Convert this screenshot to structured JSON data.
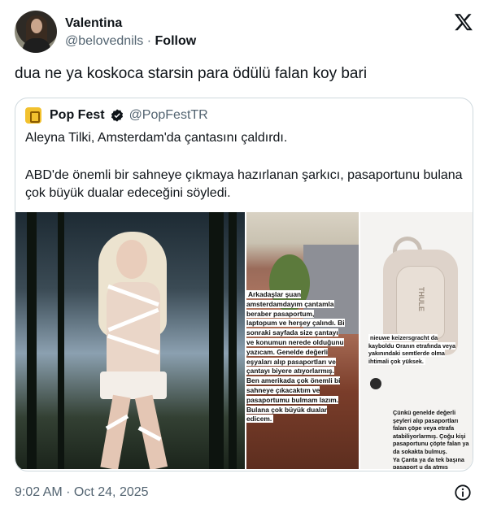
{
  "author": {
    "name": "Valentina",
    "handle": "@belovednils",
    "separator": " · ",
    "follow_label": "Follow"
  },
  "tweet": {
    "text": "dua ne ya koskoca starsin para ödülü falan koy bari",
    "timestamp": "9:02 AM · Oct 24, 2025"
  },
  "quoted": {
    "name": "Pop Fest",
    "handle": "@PopFestTR",
    "line1": "Aleyna Tilki, Amsterdam'da çantasını çaldırdı.",
    "line2": "ABD'de önemli bir sahneye çıkmaya hazırlanan şarkıcı, pasaportunu bulana çok büyük dualar edeceğini söyledi."
  },
  "media": {
    "story_text": "Arkadaşlar şuan amsterdamdayım çantamla beraber pasaportum, laptopum ve herşey çalındı. Bi sonraki sayfada size çantayı ve konumun nerede olduğunu yazıcam. Genelde değerli eşyaları alıp pasaportları ve çantayı biyere atıyorlarmış. Ben amerikada çok önemli bi sahneye çıkacaktım ve pasaportumu bulmam lazım. Bulana çok büyük dualar edicem.",
    "bag_brand": "THULE",
    "bag_note": "nieuwe keizersgracht da kayboldu Oranın etrafında veya yakınındaki semtlerde olma ihtimali çok yüksek.",
    "bag_note2": "Çünkü genelde değerli şeyleri alıp pasaportları falan çöpe veya etrafa atabiliyorlarmış. Çoğu kişi pasaportunu çöpte falan ya da sokakta bulmuş.",
    "bag_note3": "Ya Çanta ya da tek başına pasaport u da atmış olabilirler. İkisini de ayrı ayrı arayabilirsiniz. Pasaport Türk pasaportu."
  },
  "icons": {
    "x_logo": "x-logo-icon",
    "verified": "verified-badge-icon",
    "info": "info-icon"
  },
  "colors": {
    "secondary_text": "#536471",
    "border": "#cfd9de",
    "text": "#0f1419"
  }
}
